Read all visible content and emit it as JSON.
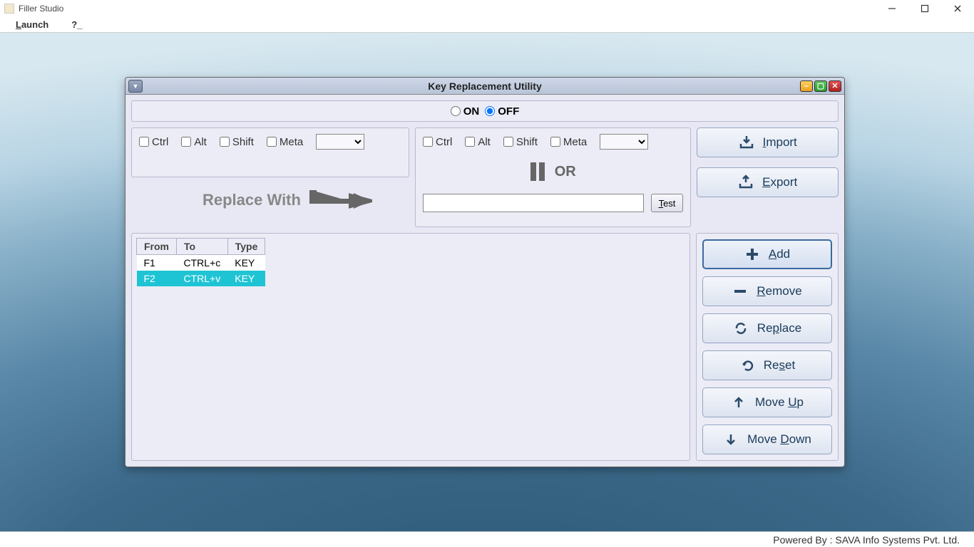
{
  "window": {
    "title": "Filler Studio"
  },
  "menubar": {
    "launch": "Launch",
    "help": "?_"
  },
  "dialog": {
    "title": "Key Replacement Utility",
    "toggle": {
      "on": "ON",
      "off": "OFF",
      "selected": "off"
    },
    "leftMods": {
      "ctrl": "Ctrl",
      "alt": "Alt",
      "shift": "Shift",
      "meta": "Meta"
    },
    "rightMods": {
      "ctrl": "Ctrl",
      "alt": "Alt",
      "shift": "Shift",
      "meta": "Meta"
    },
    "replaceWith": "Replace With",
    "or": "OR",
    "testBtn": "Test",
    "testValue": "",
    "buttons": {
      "import": "Import",
      "export": "Export",
      "add": "Add",
      "remove": "Remove",
      "replace": "Replace",
      "reset": "Reset",
      "moveUp": "Move Up",
      "moveDown": "Move Down"
    },
    "table": {
      "headers": {
        "from": "From",
        "to": "To",
        "type": "Type"
      },
      "rows": [
        {
          "from": "F1",
          "to": "CTRL+c",
          "type": "KEY",
          "selected": false
        },
        {
          "from": "F2",
          "to": "CTRL+v",
          "type": "KEY",
          "selected": true
        }
      ]
    }
  },
  "footer": "Powered By : SAVA Info Systems Pvt. Ltd."
}
